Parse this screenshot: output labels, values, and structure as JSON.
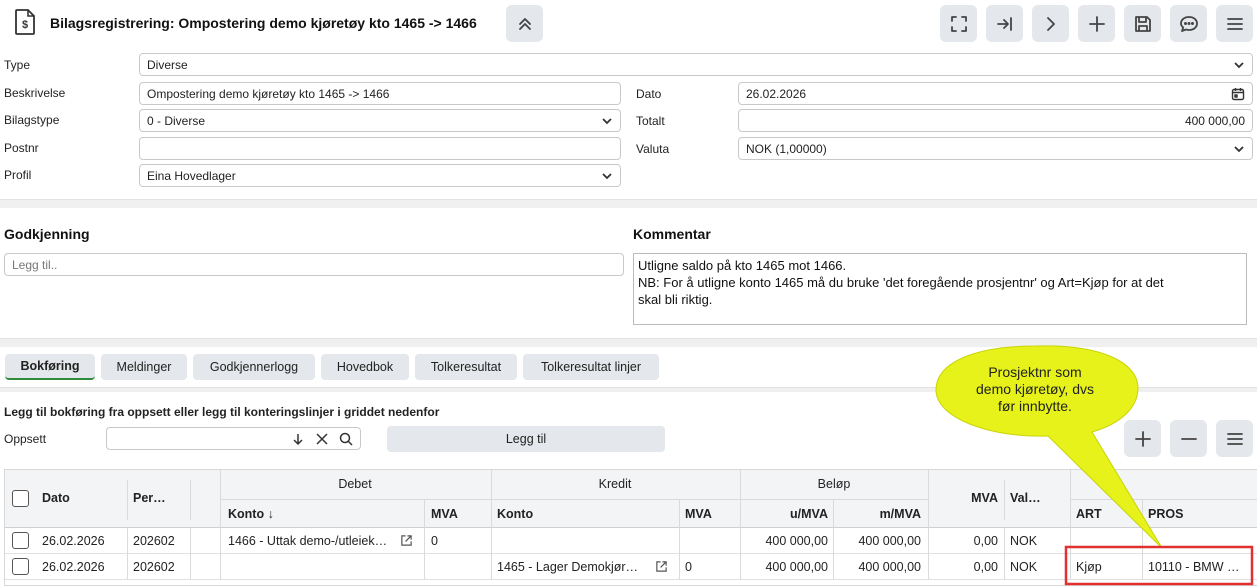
{
  "header": {
    "title": "Bilagsregistrering: Ompostering demo kjøretøy kto 1465 -> 1466"
  },
  "form": {
    "type_label": "Type",
    "type_value": "Diverse",
    "beskrivelse_label": "Beskrivelse",
    "beskrivelse_value": "Ompostering demo kjøretøy kto 1465 -> 1466",
    "bilagstype_label": "Bilagstype",
    "bilagstype_value": "0 - Diverse",
    "postnr_label": "Postnr",
    "postnr_value": "",
    "profil_label": "Profil",
    "profil_value": "Eina Hovedlager",
    "dato_label": "Dato",
    "dato_value": "26.02.2026",
    "totalt_label": "Totalt",
    "totalt_value": "400 000,00",
    "valuta_label": "Valuta",
    "valuta_value": "NOK (1,00000)"
  },
  "godkjenning": {
    "heading": "Godkjenning",
    "placeholder": "Legg til.."
  },
  "kommentar": {
    "heading": "Kommentar",
    "line1": "Utligne saldo på kto 1465 mot 1466.",
    "line2": "NB: For å utligne konto 1465 må du bruke 'det foregående prosjentnr' og Art=Kjøp for at det",
    "line3": "skal bli riktig."
  },
  "tabs": [
    "Bokføring",
    "Meldinger",
    "Godkjennerlogg",
    "Hovedbok",
    "Tolkeresultat",
    "Tolkeresultat linjer"
  ],
  "bokforing": {
    "instruction": "Legg til bokføring fra oppsett eller legg til konteringslinjer i griddet nedenfor",
    "oppsett_label": "Oppsett",
    "legg_til_button": "Legg til"
  },
  "callout": {
    "line1": "Prosjektnr som",
    "line2": "demo kjøretøy, dvs",
    "line3": "før innbytte."
  },
  "grid": {
    "group_headers": {
      "debet": "Debet",
      "kredit": "Kredit",
      "belop": "Beløp"
    },
    "columns": {
      "dato": "Dato",
      "per": "Per…",
      "konto_debet": "Konto",
      "mva_debet": "MVA",
      "konto_kredit": "Konto",
      "mva_kredit": "MVA",
      "u_mva": "u/MVA",
      "m_mva": "m/MVA",
      "mva": "MVA",
      "val": "Val…",
      "art": "ART",
      "pros": "PROS"
    },
    "rows": [
      {
        "dato": "26.02.2026",
        "per": "202602",
        "konto_debet": "1466 - Uttak demo-/utleiek…",
        "mva_debet": "0",
        "konto_kredit": "",
        "mva_kredit": "",
        "u_mva": "400 000,00",
        "m_mva": "400 000,00",
        "mva": "0,00",
        "val": "NOK",
        "art": "",
        "pros": ""
      },
      {
        "dato": "26.02.2026",
        "per": "202602",
        "konto_debet": "",
        "mva_debet": "",
        "konto_kredit": "1465 - Lager Demokjør…",
        "mva_kredit": "0",
        "u_mva": "400 000,00",
        "m_mva": "400 000,00",
        "mva": "0,00",
        "val": "NOK",
        "art": "Kjøp",
        "pros": "10110 - BMW …"
      }
    ]
  },
  "colors": {
    "accent_tab": "#2e8b3c",
    "callout": "#e6f21a",
    "highlight": "#e03030"
  }
}
